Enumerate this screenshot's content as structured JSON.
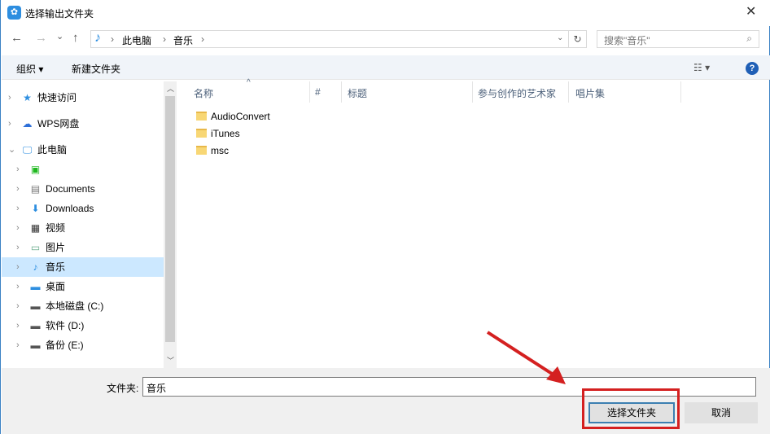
{
  "window": {
    "title": "选择输出文件夹",
    "close": "✕"
  },
  "nav": {
    "back": "←",
    "forward": "→",
    "recent": "⌄",
    "up": "↑",
    "refresh": "↻"
  },
  "address": {
    "crumbs": [
      "此电脑",
      "音乐"
    ]
  },
  "search": {
    "placeholder": "搜索\"音乐\""
  },
  "toolbar": {
    "organize": "组织 ▾",
    "new_folder": "新建文件夹",
    "view": "☷ ▾",
    "help": "?"
  },
  "tree": [
    {
      "label": "快速访问",
      "icon": "star-icon"
    },
    {
      "label": "WPS网盘",
      "icon": "cloud-icon"
    },
    {
      "label": "此电脑",
      "icon": "computer-icon"
    },
    {
      "label": "",
      "icon": "iqiyi-icon"
    },
    {
      "label": "Documents",
      "icon": "document-icon"
    },
    {
      "label": "Downloads",
      "icon": "download-icon"
    },
    {
      "label": "视频",
      "icon": "video-icon"
    },
    {
      "label": "图片",
      "icon": "picture-icon"
    },
    {
      "label": "音乐",
      "icon": "music-icon"
    },
    {
      "label": "桌面",
      "icon": "desktop-icon"
    },
    {
      "label": "本地磁盘 (C:)",
      "icon": "drive-icon"
    },
    {
      "label": "软件 (D:)",
      "icon": "drive-icon"
    },
    {
      "label": "备份 (E:)",
      "icon": "drive-icon"
    }
  ],
  "columns": [
    "名称",
    "#",
    "标题",
    "参与创作的艺术家",
    "唱片集"
  ],
  "files": [
    "AudioConvert",
    "iTunes",
    "msc"
  ],
  "footer": {
    "folder_label": "文件夹:",
    "folder_value": "音乐",
    "ok": "选择文件夹",
    "cancel": "取消"
  }
}
